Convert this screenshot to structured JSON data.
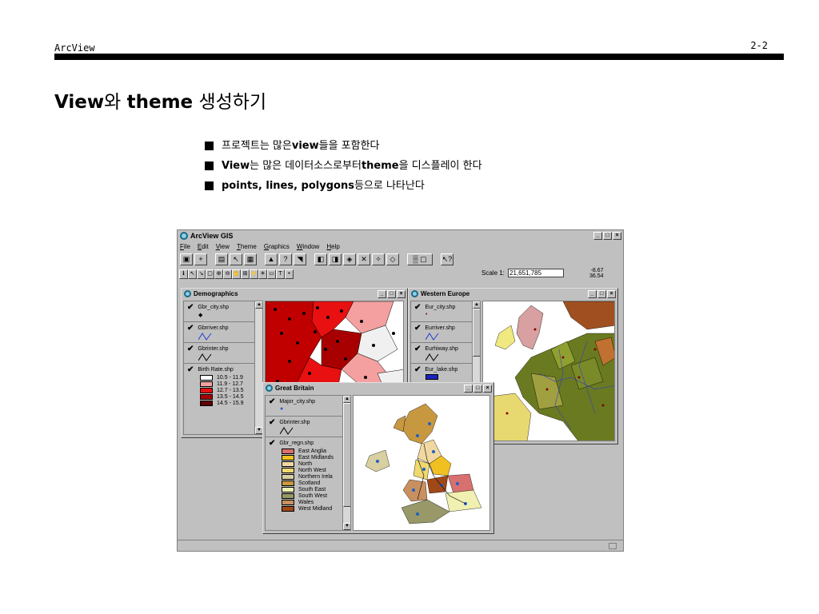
{
  "header": {
    "left": "ArcView",
    "right": "2-2"
  },
  "title": {
    "en": "View",
    "ko1": "와 ",
    "en2": "theme",
    "ko2": " 생성하기"
  },
  "bullets": [
    {
      "pre": "프로젝트는 많은 ",
      "bold": "view",
      "post": "들을 포함한다"
    },
    {
      "pre": "",
      "bold": "View",
      "post": "는 많은 데이터소스로부터 ",
      "bold2": "theme",
      "post2": "을 디스플레이 한다"
    },
    {
      "pre": "",
      "bold": "points, lines, polygons",
      "post": " 등으로 나타난다"
    }
  ],
  "app": {
    "title": "ArcView GIS",
    "menus": [
      "File",
      "Edit",
      "View",
      "Theme",
      "Graphics",
      "Window",
      "Help"
    ],
    "scale_label": "Scale 1:",
    "scale_value": "21,651,785",
    "coord_x": "-8.67",
    "coord_y": "36.54"
  },
  "windows": {
    "demographics": {
      "title": "Demographics",
      "themes": [
        "Gbr_city.shp",
        "Gbrriver.shp",
        "Gbrinter.shp",
        "Birth Rate.shp"
      ],
      "legend": [
        {
          "label": "10.5 - 11.9",
          "color": "#ffffff"
        },
        {
          "label": "11.9 - 12.7",
          "color": "#f4a0a0"
        },
        {
          "label": "12.7 - 13.5",
          "color": "#e81010"
        },
        {
          "label": "13.5 - 14.5",
          "color": "#a80000"
        },
        {
          "label": "14.5 - 15.9",
          "color": "#600000"
        }
      ]
    },
    "western_europe": {
      "title": "Western Europe",
      "themes": [
        "Eur_city.shp",
        "Eurriver.shp",
        "Eurhiway.shp",
        "Eur_lake.shp"
      ]
    },
    "great_britain": {
      "title": "Great Britain",
      "themes": [
        "Major_city.shp",
        "Gbrinter.shp",
        "Gbr_regn.shp"
      ],
      "legend": [
        {
          "label": "East Anglia",
          "color": "#d87070"
        },
        {
          "label": "East Midlands",
          "color": "#f0c020"
        },
        {
          "label": "North",
          "color": "#f0d8a0"
        },
        {
          "label": "North West",
          "color": "#f0d870"
        },
        {
          "label": "Northern Irela",
          "color": "#d8d0a0"
        },
        {
          "label": "Scotland",
          "color": "#c89840"
        },
        {
          "label": "South East",
          "color": "#f0f0b0"
        },
        {
          "label": "South West",
          "color": "#989868"
        },
        {
          "label": "Wales",
          "color": "#c89060"
        },
        {
          "label": "West Midland",
          "color": "#a04818"
        }
      ]
    }
  }
}
